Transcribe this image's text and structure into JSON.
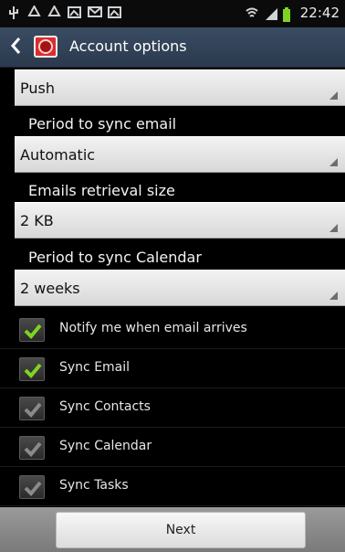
{
  "status_bar": {
    "time": "22:42",
    "left_icons": [
      "usb-icon",
      "recycle-icon",
      "recycle-icon",
      "image-icon",
      "mail-icon",
      "image-icon"
    ],
    "right_icons": [
      "wifi-icon",
      "signal-icon",
      "battery-icon"
    ]
  },
  "header": {
    "title": "Account options"
  },
  "settings": {
    "push_value": "Push",
    "period_sync_email_label": "Period to sync email",
    "period_sync_email_value": "Automatic",
    "retrieval_size_label": "Emails retrieval size",
    "retrieval_size_value": "2 KB",
    "period_sync_calendar_label": "Period to sync Calendar",
    "period_sync_calendar_value": "2 weeks"
  },
  "checkboxes": [
    {
      "label": "Notify me when email arrives",
      "checked": true
    },
    {
      "label": "Sync Email",
      "checked": true
    },
    {
      "label": "Sync Contacts",
      "checked": false
    },
    {
      "label": "Sync Calendar",
      "checked": false
    },
    {
      "label": "Sync Tasks",
      "checked": false
    }
  ],
  "footer": {
    "next_label": "Next"
  },
  "colors": {
    "check_on": "#7fd323",
    "check_off": "#8a8a8a",
    "header_bg": "#34465c"
  }
}
